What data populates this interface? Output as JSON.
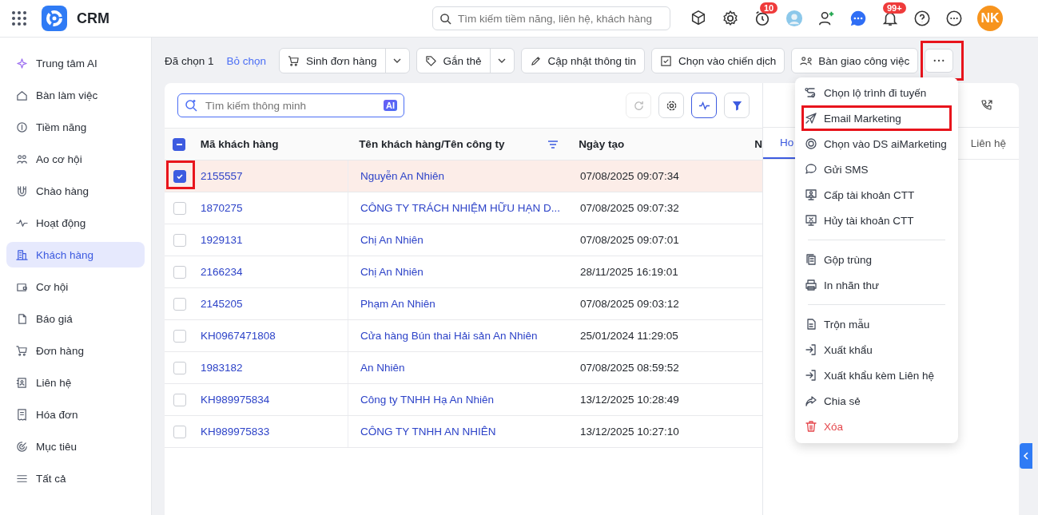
{
  "app": {
    "name": "CRM"
  },
  "search": {
    "placeholder": "Tìm kiếm tiềm năng, liên hệ, khách hàng"
  },
  "header_badges": {
    "timer": "10",
    "notifications": "99+"
  },
  "user": {
    "initials": "NK"
  },
  "sidebar": {
    "items": [
      {
        "label": "Trung tâm AI",
        "selected": false
      },
      {
        "label": "Bàn làm việc",
        "selected": false
      },
      {
        "label": "Tiềm năng",
        "selected": false
      },
      {
        "label": "Ao cơ hội",
        "selected": false
      },
      {
        "label": "Chào hàng",
        "selected": false
      },
      {
        "label": "Hoạt động",
        "selected": false
      },
      {
        "label": "Khách hàng",
        "selected": true
      },
      {
        "label": "Cơ hội",
        "selected": false
      },
      {
        "label": "Báo giá",
        "selected": false
      },
      {
        "label": "Đơn hàng",
        "selected": false
      },
      {
        "label": "Liên hệ",
        "selected": false
      },
      {
        "label": "Hóa đơn",
        "selected": false
      },
      {
        "label": "Mục tiêu",
        "selected": false
      },
      {
        "label": "Tất cả",
        "selected": false
      }
    ]
  },
  "selection_bar": {
    "count_text": "Đã chọn 1",
    "clear_link": "Bỏ chọn",
    "actions": [
      {
        "label": "Sinh đơn hàng",
        "has_menu": true
      },
      {
        "label": "Gắn thẻ",
        "has_menu": true
      },
      {
        "label": "Cập nhật thông tin",
        "has_menu": false
      },
      {
        "label": "Chọn vào chiến dịch",
        "has_menu": false
      },
      {
        "label": "Bàn giao công việc",
        "has_menu": false
      }
    ],
    "more_highlighted": true
  },
  "table": {
    "smart_search": {
      "placeholder": "Tìm kiếm thông minh",
      "badge": "AI"
    },
    "header_checkbox_indeterminate": true,
    "columns": [
      "Mã khách hàng",
      "Tên khách hàng/Tên công ty",
      "Ngày tạo",
      "N"
    ],
    "rows": [
      {
        "code": "2155557",
        "name": "Nguyễn An Nhiên",
        "created": "07/08/2025 09:07:34",
        "selected": true,
        "highlighted": true
      },
      {
        "code": "1870275",
        "name": "CÔNG TY TRÁCH NHIỆM HỮU HẠN D...",
        "created": "07/08/2025 09:07:32",
        "selected": false,
        "highlighted": false
      },
      {
        "code": "1929131",
        "name": "Chị An Nhiên",
        "created": "07/08/2025 09:07:01",
        "selected": false,
        "highlighted": false
      },
      {
        "code": "2166234",
        "name": "Chị An Nhiên",
        "created": "28/11/2025 16:19:01",
        "selected": false,
        "highlighted": false
      },
      {
        "code": "2145205",
        "name": "Phạm An Nhiên",
        "created": "07/08/2025 09:03:12",
        "selected": false,
        "highlighted": false
      },
      {
        "code": "KH0967471808",
        "name": "Cửa hàng Bún thai Hải sản An Nhiên",
        "created": "25/01/2024 11:29:05",
        "selected": false,
        "highlighted": false
      },
      {
        "code": "1983182",
        "name": "An Nhiên",
        "created": "07/08/2025 08:59:52",
        "selected": false,
        "highlighted": false
      },
      {
        "code": "KH989975834",
        "name": "Công ty TNHH Hạ An Nhiên",
        "created": "13/12/2025 10:28:49",
        "selected": false,
        "highlighted": false
      },
      {
        "code": "KH989975833",
        "name": "CÔNG TY TNHH AN NHIÊN",
        "created": "13/12/2025 10:27:10",
        "selected": false,
        "highlighted": false
      }
    ]
  },
  "detail_panel": {
    "tabs": [
      {
        "label": "Ho",
        "selected": true
      },
      {
        "label": "Liên hệ",
        "selected": false
      }
    ]
  },
  "more_menu": {
    "groups": [
      [
        {
          "label": "Chọn lộ trình đi tuyến",
          "destructive": false,
          "highlighted": false
        },
        {
          "label": "Email Marketing",
          "destructive": false,
          "highlighted": true
        },
        {
          "label": "Chọn vào DS aiMarketing",
          "destructive": false,
          "highlighted": false
        },
        {
          "label": "Gửi SMS",
          "destructive": false,
          "highlighted": false
        },
        {
          "label": "Cấp tài khoản CTT",
          "destructive": false,
          "highlighted": false
        },
        {
          "label": "Hủy tài khoản CTT",
          "destructive": false,
          "highlighted": false
        }
      ],
      [
        {
          "label": "Gộp trùng",
          "destructive": false,
          "highlighted": false
        },
        {
          "label": "In nhãn thư",
          "destructive": false,
          "highlighted": false
        }
      ],
      [
        {
          "label": "Trộn mẫu",
          "destructive": false,
          "highlighted": false
        },
        {
          "label": "Xuất khẩu",
          "destructive": false,
          "highlighted": false
        },
        {
          "label": "Xuất khẩu kèm Liên hệ",
          "destructive": false,
          "highlighted": false
        },
        {
          "label": "Chia sẻ",
          "destructive": false,
          "highlighted": false
        },
        {
          "label": "Xóa",
          "destructive": true,
          "highlighted": false
        }
      ]
    ]
  }
}
